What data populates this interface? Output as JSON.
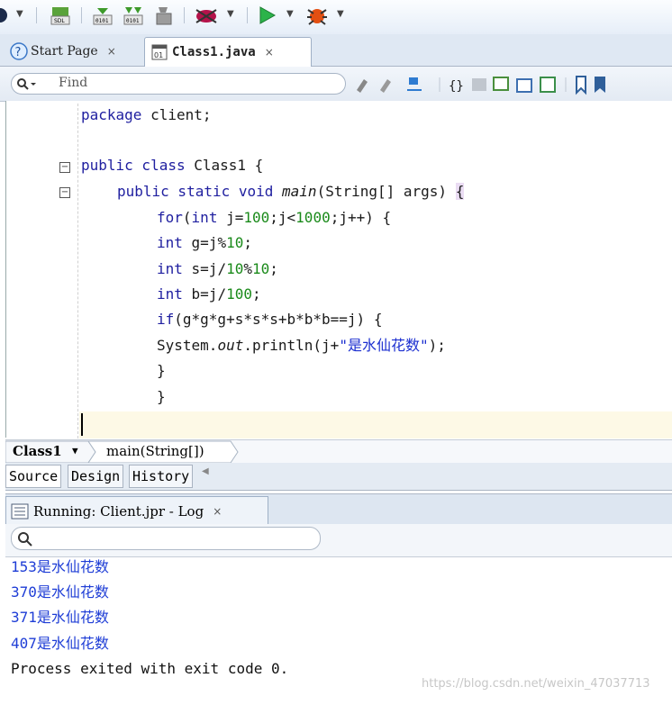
{
  "toolbar": {
    "icons": [
      "circle-icon",
      "manage-libraries-icon",
      "compile-icon",
      "rebuild-icon",
      "clean-icon",
      "debug-icon",
      "run-icon",
      "profile-icon"
    ]
  },
  "tabs": [
    {
      "label": "Start Page",
      "close": "×"
    },
    {
      "label": "Class1.java",
      "close": "×"
    }
  ],
  "find": {
    "placeholder": "Find"
  },
  "code": [
    "package client;",
    "",
    "public class Class1 {",
    "    public static void main(String[] args) {",
    "        for(int j=100;j<1000;j++) {",
    "        int g=j%10;",
    "        int s=j/10%10;",
    "        int b=j/100;",
    "        if(g*g*g+s*s*s+b*b*b==j) {",
    "        System.out.println(j+\"是水仙花数\");",
    "        }",
    "        }"
  ],
  "breadcrumb": {
    "class": "Class1",
    "method": "main(String[])"
  },
  "bottom_tabs": [
    "Source",
    "Design",
    "History"
  ],
  "log": {
    "tab_label": "Running: Client.jpr - Log",
    "close": "×",
    "output": [
      "153是水仙花数",
      "370是水仙花数",
      "371是水仙花数",
      "407是水仙花数"
    ],
    "exit_message": "Process exited with exit code 0."
  },
  "watermark": "https://blog.csdn.net/weixin_47037713"
}
